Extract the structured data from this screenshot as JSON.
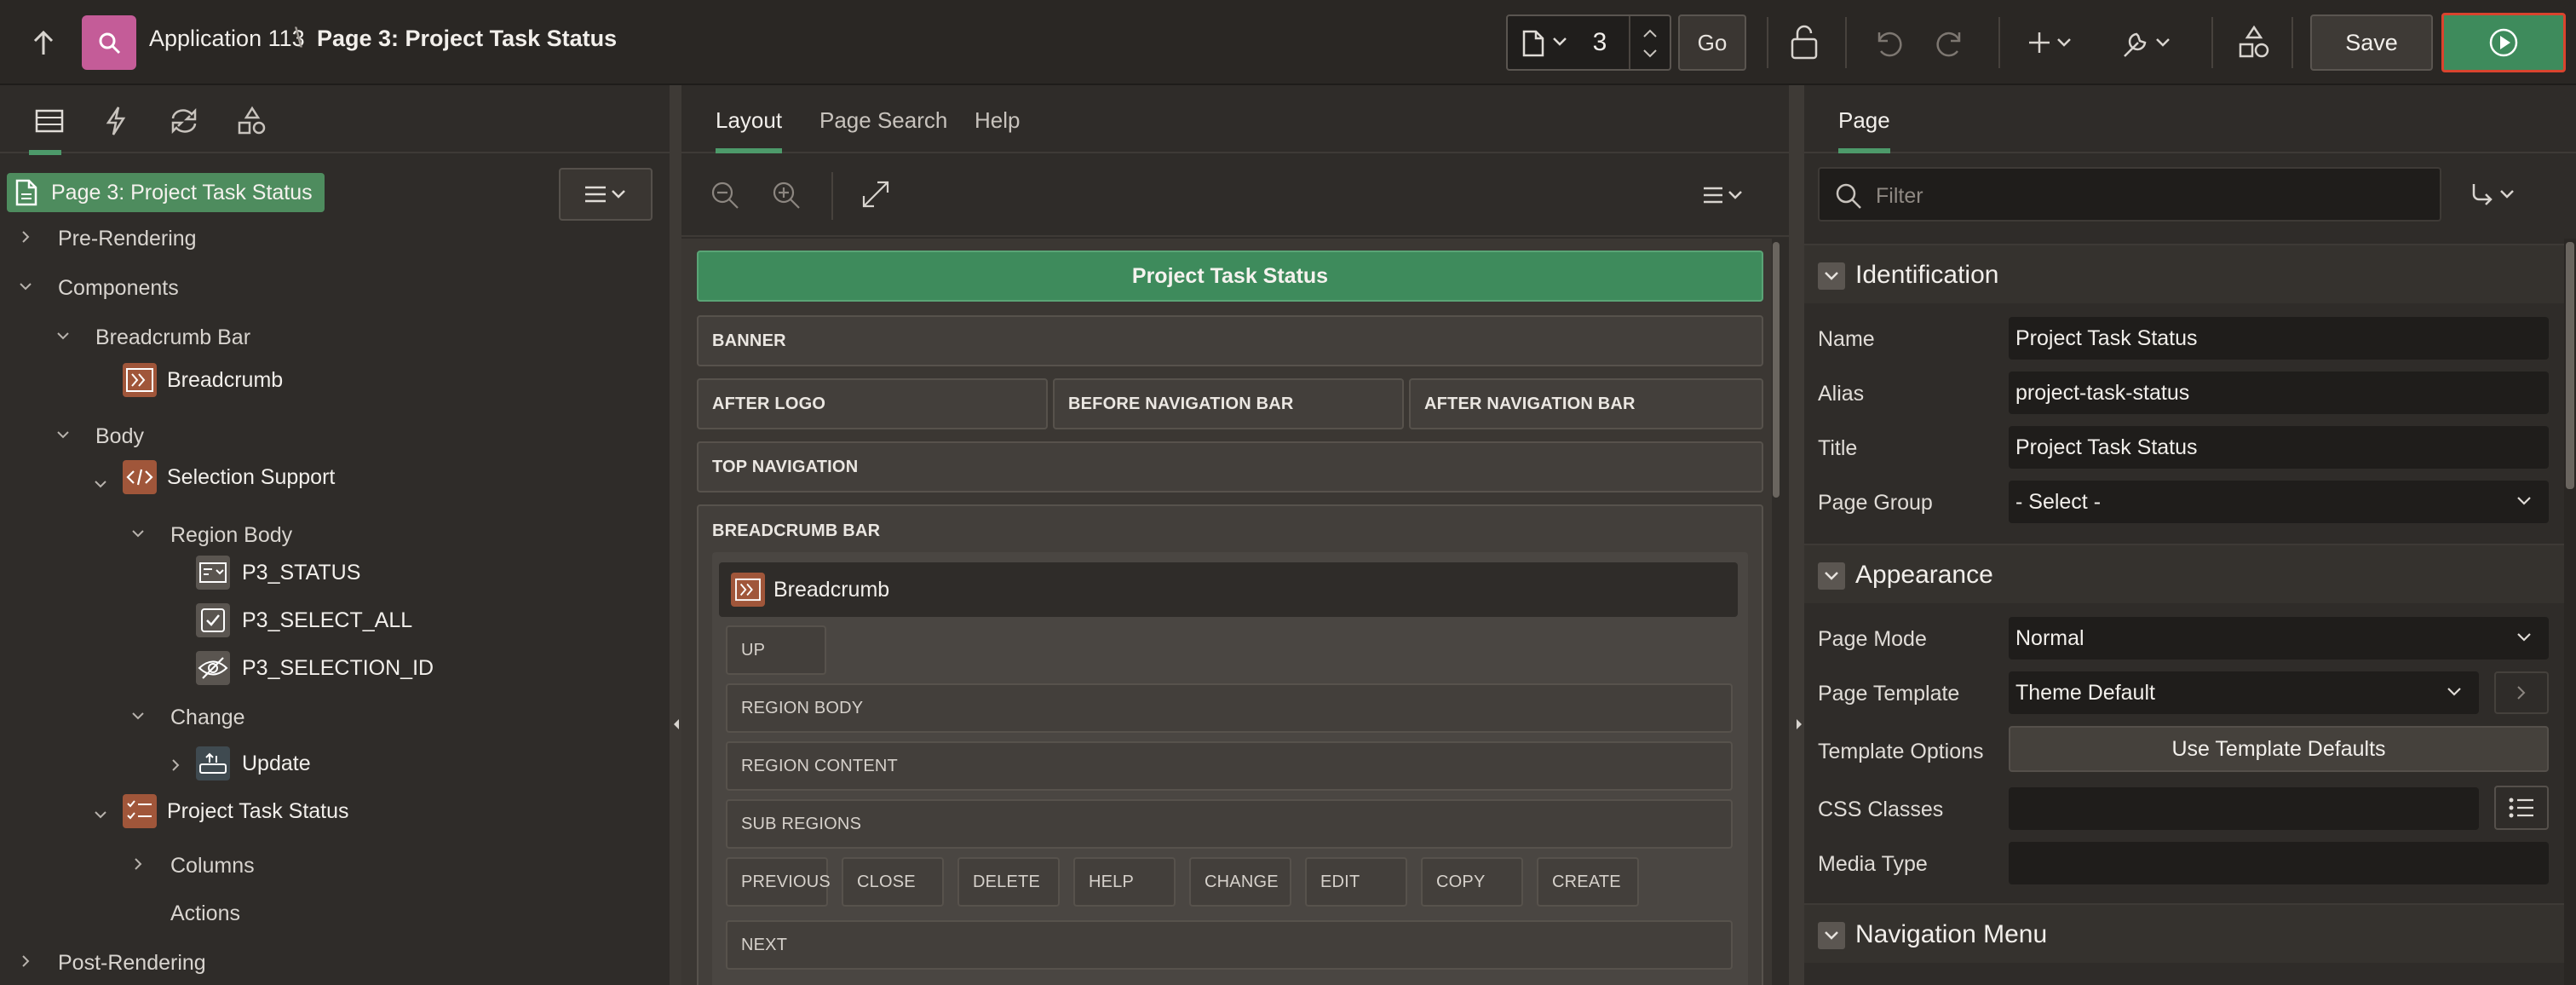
{
  "header": {
    "app_name": "Application 113",
    "separator": "\\",
    "page_name": "Page 3: Project Task Status",
    "page_number": "3",
    "go_label": "Go",
    "save_label": "Save",
    "icons": [
      "up-arrow-icon",
      "app-search-icon",
      "page-icon",
      "lock-icon",
      "undo-icon",
      "redo-icon",
      "plus-icon",
      "wrench-icon",
      "shared-components-icon",
      "run-icon"
    ],
    "run_color": "#3e8b5c",
    "run_highlight_border": "#d9442e"
  },
  "left_panel": {
    "tabs": [
      "rendering-tab",
      "dynamic-actions-tab",
      "processing-tab",
      "shared-components-tab"
    ],
    "root": "Page 3: Project Task Status",
    "tree": [
      {
        "label": "Pre-Rendering"
      },
      {
        "label": "Components"
      },
      {
        "label": "Breadcrumb Bar"
      },
      {
        "label": "Breadcrumb"
      },
      {
        "label": "Body"
      },
      {
        "label": "Selection Support"
      },
      {
        "label": "Region Body"
      },
      {
        "label": "P3_STATUS"
      },
      {
        "label": "P3_SELECT_ALL"
      },
      {
        "label": "P3_SELECTION_ID"
      },
      {
        "label": "Change"
      },
      {
        "label": "Update"
      },
      {
        "label": "Project Task Status"
      },
      {
        "label": "Columns"
      },
      {
        "label": "Actions"
      },
      {
        "label": "Post-Rendering"
      }
    ],
    "accent": "#4e8c5e"
  },
  "layout_panel": {
    "tabs": [
      "Layout",
      "Page Search",
      "Help"
    ],
    "page_title": "Project Task Status",
    "slots": {
      "banner": "BANNER",
      "after_logo": "AFTER LOGO",
      "before_nav": "BEFORE NAVIGATION BAR",
      "after_nav": "AFTER NAVIGATION BAR",
      "top_nav": "TOP NAVIGATION",
      "breadcrumb_bar": "BREADCRUMB BAR",
      "breadcrumb_region": "Breadcrumb",
      "up": "UP",
      "region_body": "REGION BODY",
      "region_content": "REGION CONTENT",
      "sub_regions": "SUB REGIONS",
      "buttons": [
        "PREVIOUS",
        "CLOSE",
        "DELETE",
        "HELP",
        "CHANGE",
        "EDIT",
        "COPY",
        "CREATE"
      ],
      "next": "NEXT"
    }
  },
  "property_panel": {
    "tab": "Page",
    "filter_placeholder": "Filter",
    "identification": {
      "title": "Identification",
      "name_label": "Name",
      "name_value": "Project Task Status",
      "alias_label": "Alias",
      "alias_value": "project-task-status",
      "title_label": "Title",
      "title_value": "Project Task Status",
      "group_label": "Page Group",
      "group_value": "- Select -"
    },
    "appearance": {
      "title": "Appearance",
      "mode_label": "Page Mode",
      "mode_value": "Normal",
      "template_label": "Page Template",
      "template_value": "Theme Default",
      "options_label": "Template Options",
      "options_button": "Use Template Defaults",
      "css_label": "CSS Classes",
      "css_value": "",
      "media_label": "Media Type",
      "media_value": ""
    },
    "navigation_menu": {
      "title": "Navigation Menu"
    }
  }
}
